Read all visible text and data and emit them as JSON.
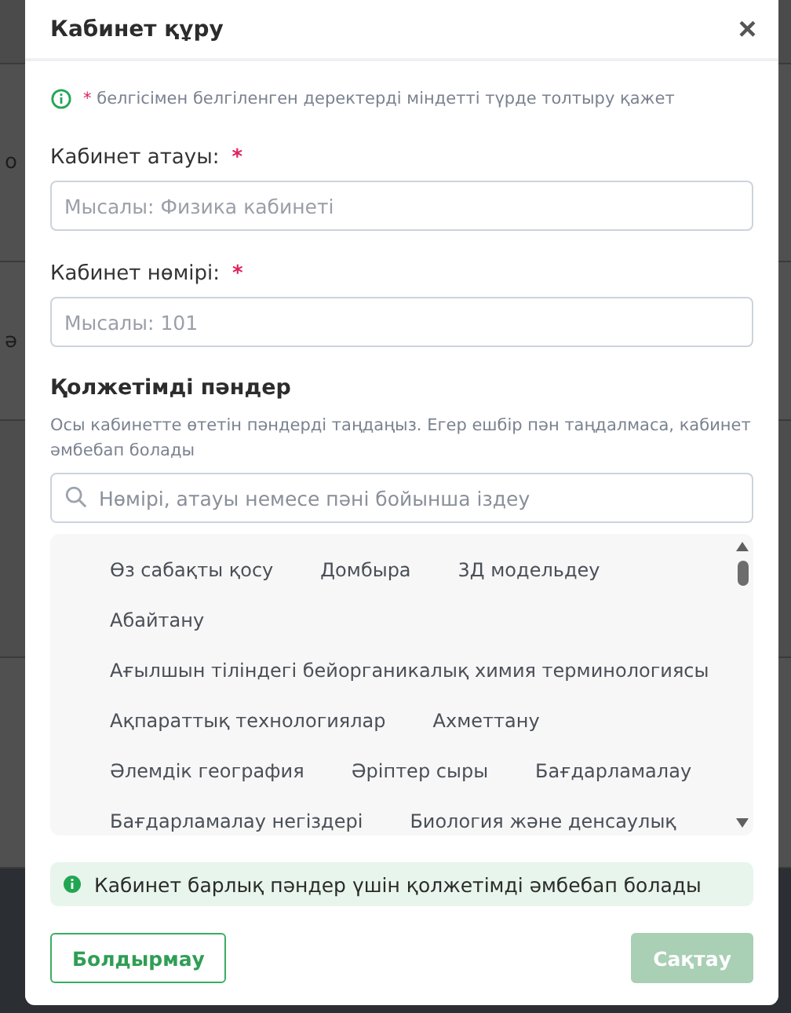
{
  "background_fragments": [
    "о",
    "ә"
  ],
  "dialog": {
    "title": "Кабинет құру",
    "close": "×"
  },
  "required_note": {
    "mark": "*",
    "text": "белгісімен белгіленген деректерді міндетті түрде толтыру қажет"
  },
  "fields": [
    {
      "label": "Кабинет атауы:",
      "required": true,
      "placeholder": "Мысалы: Физика кабинеті"
    },
    {
      "label": "Кабинет нөмірі:",
      "required": true,
      "placeholder": "Мысалы: 101"
    }
  ],
  "subjects": {
    "title": "Қолжетімді пәндер",
    "description": "Осы кабинетте өтетін пәндерді таңдаңыз. Егер ешбір пән таңдалмаса, кабинет әмбебап болады",
    "search_placeholder": "Нөмірі, атауы немесе пәні бойынша іздеу",
    "items": [
      "Өз сабақты қосу",
      "Домбыра",
      "3Д модельдеу",
      "Абайтану",
      "Ағылшын тіліндегі бейорганикалық химия терминологиясы",
      "Ақпараттық технологиялар",
      "Ахметтану",
      "Әлемдік география",
      "Әріптер сыры",
      "Бағдарламалау",
      "Бағдарламалау негіздері",
      "Биология және денсаулық"
    ]
  },
  "info_banner": "Кабинет барлық пәндер үшін қолжетімді әмбебап болады",
  "buttons": [
    {
      "label": "Болдырмау",
      "kind": "secondary",
      "disabled": false
    },
    {
      "label": "Сақтау",
      "kind": "primary",
      "disabled": true
    }
  ]
}
